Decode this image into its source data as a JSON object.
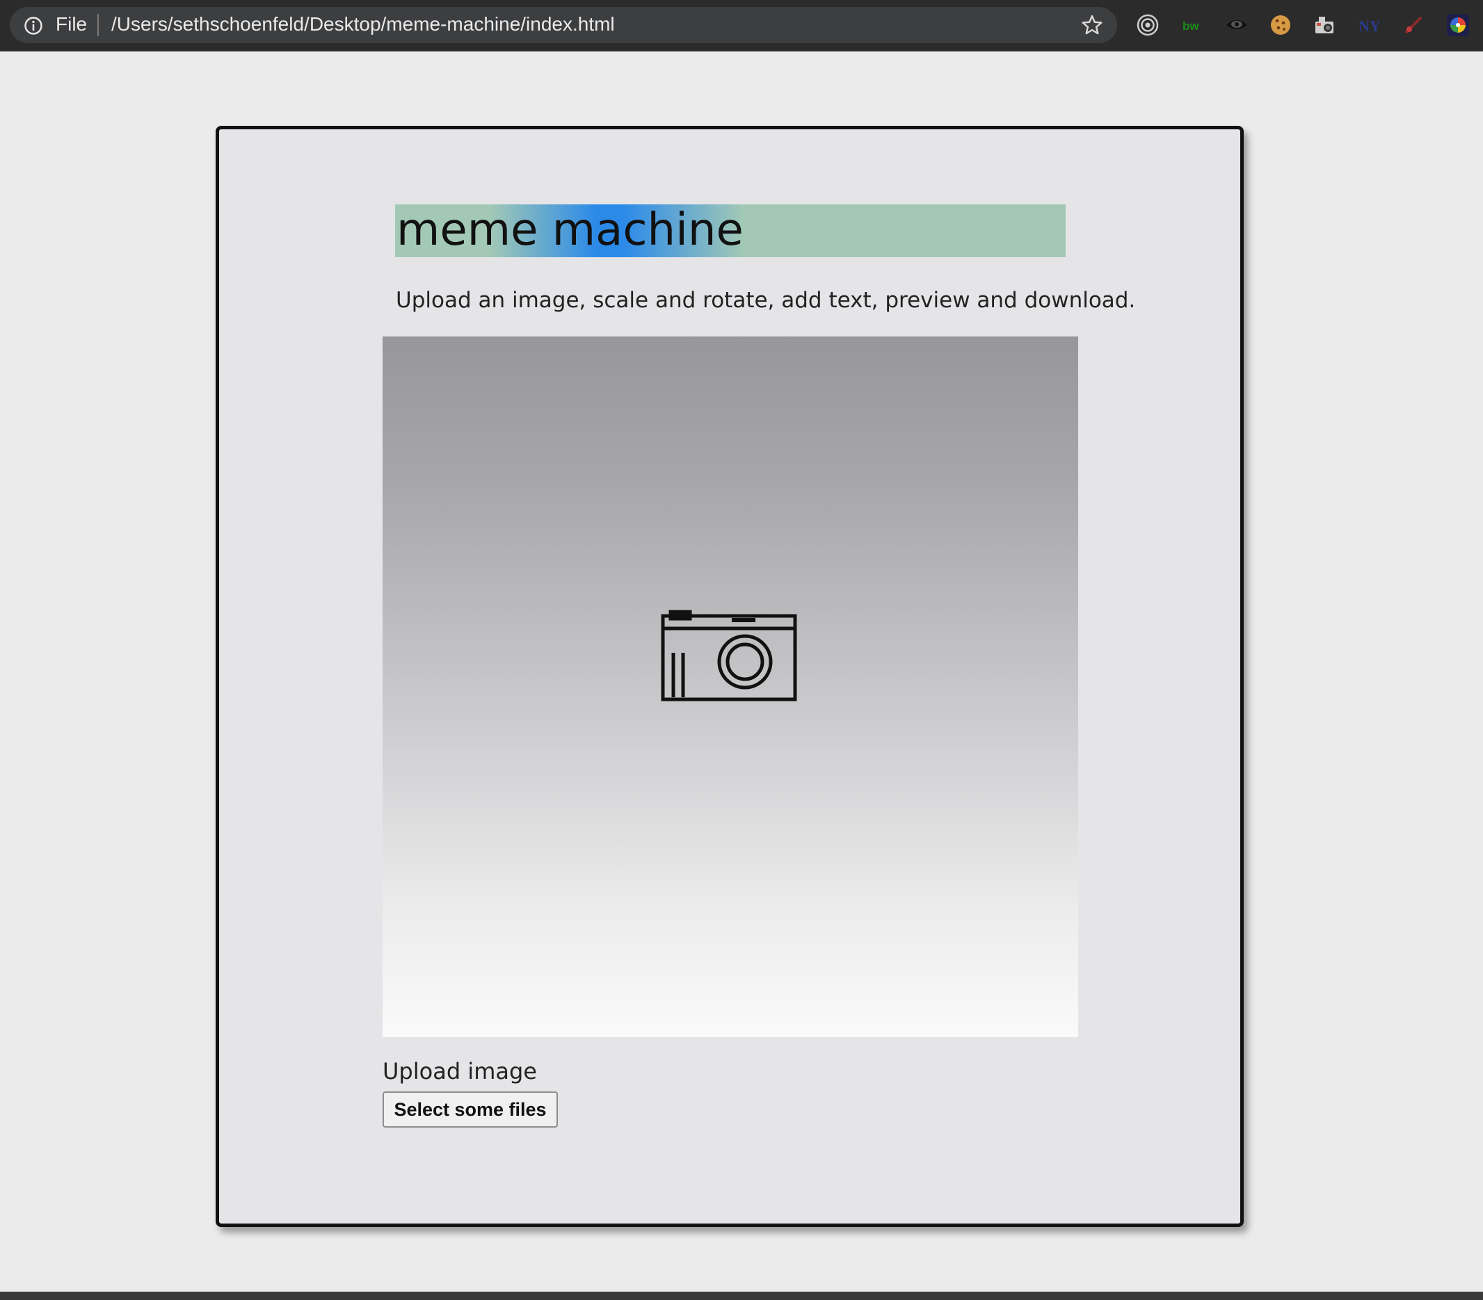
{
  "browser": {
    "scheme_label": "File",
    "url": "/Users/sethschoenfeld/Desktop/meme-machine/index.html",
    "extensions": [
      {
        "name": "target-icon",
        "color": "#cfcfcf"
      },
      {
        "name": "bw-extension-icon",
        "label": "bw",
        "color": "#1a8a1a"
      },
      {
        "name": "eye-extension-icon",
        "color": "#111111"
      },
      {
        "name": "cookie-extension-icon",
        "color": "#d79a45"
      },
      {
        "name": "camera-extension-icon",
        "color": "#cccccc"
      },
      {
        "name": "nyt-extension-icon",
        "label": "NY",
        "color": "#2a3a8f"
      },
      {
        "name": "pen-extension-icon",
        "color": "#c83a3a"
      },
      {
        "name": "color-wheel-extension-icon",
        "color": "#6b3ad6"
      }
    ]
  },
  "app": {
    "title": "meme machine",
    "subtitle": "Upload an image, scale and rotate, add text, preview and download.",
    "title_gradient": {
      "green": "#a3c9b6",
      "blue": "#2b8ae8"
    },
    "preview_icon": "camera-icon",
    "upload": {
      "label": "Upload image",
      "button_label": "Select some files"
    }
  }
}
